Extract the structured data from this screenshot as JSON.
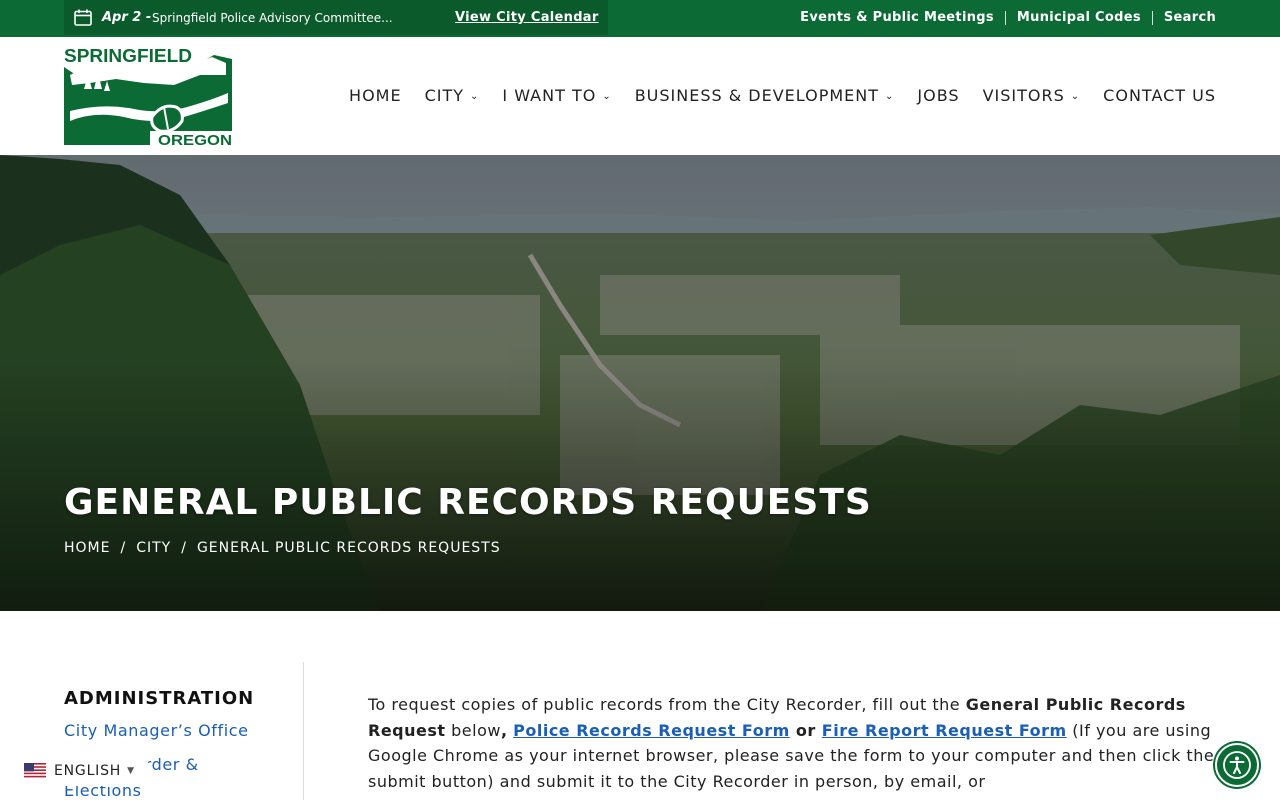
{
  "topbar": {
    "alert_date": "Apr 2 -",
    "alert_text": "Springfield Police Advisory Committee...",
    "calendar_link": "View City Calendar",
    "util_links": [
      "Events & Public Meetings",
      "Municipal Codes",
      "Search"
    ]
  },
  "logo": {
    "top_text": "SPRINGFIELD",
    "bottom_text": "OREGON"
  },
  "nav": {
    "items": [
      "HOME",
      "CITY",
      "I WANT TO",
      "BUSINESS & DEVELOPMENT",
      "JOBS",
      "VISITORS",
      "CONTACT US"
    ],
    "has_dropdown": [
      false,
      true,
      true,
      true,
      false,
      true,
      false
    ]
  },
  "hero": {
    "title": "GENERAL PUBLIC RECORDS REQUESTS",
    "breadcrumb": [
      "HOME",
      "CITY",
      "GENERAL PUBLIC RECORDS REQUESTS"
    ],
    "breadcrumb_sep": "/"
  },
  "sidebar": {
    "heading": "ADMINISTRATION",
    "links": [
      "City Manager’s Office",
      "City Recorder & Elections"
    ]
  },
  "main": {
    "p1_a": "To request copies of public records from the City Recorder, fill out the ",
    "p1_b": "General Public Records Request",
    "p1_c": " below",
    "p1_comma": ",",
    "link1": "Police Records Request Form",
    "p1_or": " or ",
    "link2": "Fire Report Request Form",
    "p1_d": " (If you are using Google Chrome as your internet browser, please save the form to your computer and then click the submit button) and submit it to the City Recorder in person, by email, or"
  },
  "translate": {
    "label": "ENGLISH",
    "flag": "us-flag-icon"
  },
  "colors": {
    "brand_green": "#0c6b35",
    "link_blue": "#1a5fb4"
  }
}
